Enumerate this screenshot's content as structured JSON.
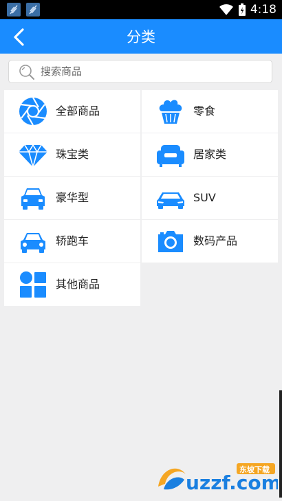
{
  "status_bar": {
    "time": "4:18"
  },
  "header": {
    "title": "分类",
    "back_icon": "chevron-left-icon"
  },
  "search": {
    "placeholder": "搜索商品",
    "value": ""
  },
  "categories": [
    {
      "label": "全部商品",
      "icon": "aperture-icon"
    },
    {
      "label": "零食",
      "icon": "cupcake-icon"
    },
    {
      "label": "珠宝类",
      "icon": "diamond-icon"
    },
    {
      "label": "居家类",
      "icon": "sofa-icon"
    },
    {
      "label": "豪华型",
      "icon": "car-front-icon"
    },
    {
      "label": "SUV",
      "icon": "car-side-icon"
    },
    {
      "label": "轿跑车",
      "icon": "sedan-icon"
    },
    {
      "label": "数码产品",
      "icon": "camera-icon"
    },
    {
      "label": "其他商品",
      "icon": "grid-blocks-icon"
    }
  ],
  "watermark": {
    "brand": "uzzf.com",
    "tagline": "东坡下载"
  },
  "colors": {
    "primary": "#1a8cff",
    "background": "#efeff0",
    "cell": "#ffffff"
  }
}
